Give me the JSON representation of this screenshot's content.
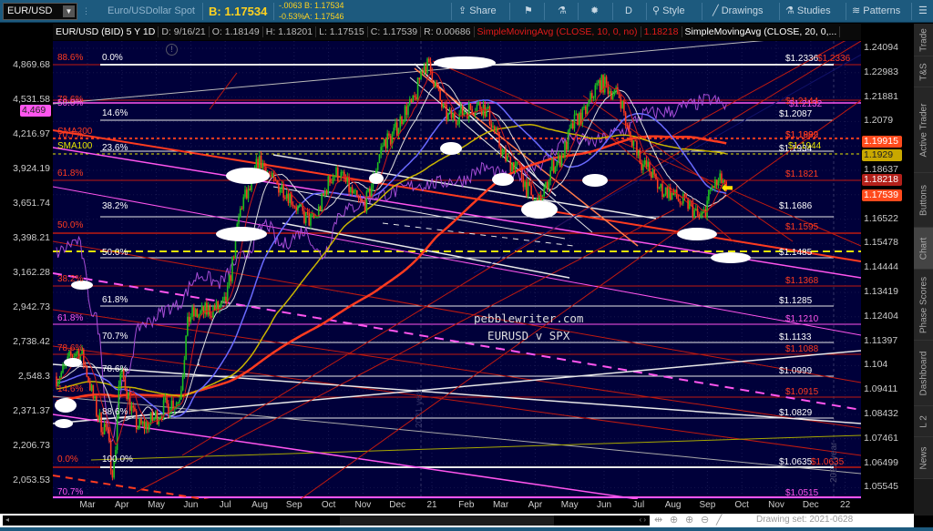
{
  "toolbar": {
    "symbol": "EUR/USD",
    "description": "Euro/USDollar Spot",
    "bid_big": "B: 1.17534",
    "change": "-.0063",
    "change_pct": "-0.53%",
    "bid": "B: 1.17534",
    "ask": "A: 1.17546",
    "share": "Share",
    "period": "D",
    "style": "Style",
    "drawings": "Drawings",
    "studies": "Studies",
    "patterns": "Patterns"
  },
  "infobar": {
    "title": "EUR/USD (BID) 5 Y 1D",
    "date": "D: 9/16/21",
    "open": "O: 1.18149",
    "high": "H: 1.18201",
    "low": "L: 1.17515",
    "close": "C: 1.17539",
    "range": "R: 0.00686",
    "sma10": "SimpleMovingAvg (CLOSE, 10, 0, no)",
    "sma10_value": "1.18218",
    "sma20": "SimpleMovingAvg (CLOSE, 20, 0,..."
  },
  "left_axis": [
    "4,869.68",
    "4,531.58",
    "4,216.97",
    "3,924.19",
    "3,651.74",
    "3,398.21",
    "3,162.28",
    "2,942.73",
    "2,738.42",
    "2,548.3",
    "2,371.37",
    "2,206.73",
    "2,053.53"
  ],
  "left_tag": "4,469",
  "right_axis": [
    "1.24094",
    "1.22983",
    "1.21881",
    "1.2079",
    "1.19705",
    "1.18637",
    "1.17580",
    "1.16522",
    "1.15478",
    "1.14444",
    "1.13419",
    "1.12404",
    "1.11397",
    "1.104",
    "1.09411",
    "1.08432",
    "1.07461",
    "1.06499",
    "1.05545"
  ],
  "price_tags": [
    {
      "text": "1.19915",
      "color": "#ff4a1c"
    },
    {
      "text": "1.1929",
      "color": "#c9a800"
    },
    {
      "text": "1.18218",
      "color": "#b3201a"
    },
    {
      "text": "1.17539",
      "color": "#ff4a1c"
    }
  ],
  "x_axis": [
    "Mar",
    "Apr",
    "May",
    "Jun",
    "Jul",
    "Aug",
    "Sep",
    "Oct",
    "Nov",
    "Dec",
    "21",
    "Feb",
    "Mar",
    "Apr",
    "May",
    "Jun",
    "Jul",
    "Aug",
    "Sep",
    "Oct",
    "Nov",
    "Dec",
    "22"
  ],
  "fib_left": [
    {
      "text": "88.6%",
      "color": "#ff3b1f"
    },
    {
      "text": "0.0%",
      "color": "#ffffff"
    },
    {
      "text": "78.6%",
      "color": "#ff3b1f"
    },
    {
      "text": "50.0%",
      "color": "#ff55ee"
    },
    {
      "text": "14.6%",
      "color": "#ffffff"
    },
    {
      "text": "SMA200",
      "color": "#ff3b1f"
    },
    {
      "text": "70.7%",
      "color": "#ff3b1f"
    },
    {
      "text": "SMA100",
      "color": "#e6e600"
    },
    {
      "text": "23.6%",
      "color": "#ffffff"
    },
    {
      "text": "61.8%",
      "color": "#ff3b1f"
    },
    {
      "text": "38.2%",
      "color": "#ffffff"
    },
    {
      "text": "50.0%",
      "color": "#ff3b1f"
    },
    {
      "text": "50.0%",
      "color": "#ffffff"
    },
    {
      "text": "38.2%",
      "color": "#ff3b1f"
    },
    {
      "text": "61.8%",
      "color": "#ffffff"
    },
    {
      "text": "61.8%",
      "color": "#ff55ee"
    },
    {
      "text": "70.7%",
      "color": "#ffffff"
    },
    {
      "text": "78.6%",
      "color": "#ff3b1f"
    },
    {
      "text": "78.6%",
      "color": "#ffffff"
    },
    {
      "text": "14.6%",
      "color": "#ff3b1f"
    },
    {
      "text": "88.6%",
      "color": "#ffffff"
    },
    {
      "text": "0.0%",
      "color": "#ff3b1f"
    },
    {
      "text": "100.0%",
      "color": "#ffffff"
    },
    {
      "text": "70.7%",
      "color": "#ff55ee"
    }
  ],
  "fib_right": [
    {
      "text": "$1.2336",
      "color": "#ffffff",
      "price": 1.2336
    },
    {
      "text": "$1.2336",
      "color": "#ff3b1f",
      "price": 1.2336
    },
    {
      "text": "$1.2144",
      "color": "#ff3b1f",
      "price": 1.2144
    },
    {
      "text": "$1.2132",
      "color": "#ff55ee",
      "price": 1.2132
    },
    {
      "text": "$1.2087",
      "color": "#ffffff",
      "price": 1.2087
    },
    {
      "text": "$1.1889",
      "color": "#ff3b1f",
      "price": 1.1995
    },
    {
      "text": "$1.1992",
      "color": "#ff3b1f",
      "price": 1.1992
    },
    {
      "text": "$1.1934",
      "color": "#ffffff",
      "price": 1.1934
    },
    {
      "text": "$1.1944",
      "color": "#e6e600",
      "price": 1.1944
    },
    {
      "text": "$1.1821",
      "color": "#ff3b1f",
      "price": 1.1821
    },
    {
      "text": "$1.1686",
      "color": "#ffffff",
      "price": 1.1686
    },
    {
      "text": "$1.1595",
      "color": "#ff3b1f",
      "price": 1.1595
    },
    {
      "text": "$1.1485",
      "color": "#ffffff",
      "price": 1.1485
    },
    {
      "text": "$1.1368",
      "color": "#ff3b1f",
      "price": 1.1368
    },
    {
      "text": "$1.1285",
      "color": "#ffffff",
      "price": 1.1285
    },
    {
      "text": "$1.1210",
      "color": "#ff55ee",
      "price": 1.121
    },
    {
      "text": "$1.1133",
      "color": "#ffffff",
      "price": 1.1133
    },
    {
      "text": "$1.1088",
      "color": "#ff3b1f",
      "price": 1.1088
    },
    {
      "text": "$1.0999",
      "color": "#ffffff",
      "price": 1.0999
    },
    {
      "text": "$1.0915",
      "color": "#ff3b1f",
      "price": 1.0915
    },
    {
      "text": "$1.0829",
      "color": "#ffffff",
      "price": 1.0829
    },
    {
      "text": "$1.0635",
      "color": "#ffffff",
      "price": 1.0635
    },
    {
      "text": "$1.0635",
      "color": "#ff3b1f",
      "price": 1.0635
    },
    {
      "text": "$1.0515",
      "color": "#ff55ee",
      "price": 1.0515
    }
  ],
  "watermark": {
    "line1": "pebblewriter.com",
    "line2": "EURUSD v SPX"
  },
  "year_marker": "2021 year",
  "tabs": [
    "Trade",
    "T&S",
    "Active Trader",
    "Buttons",
    "Chart",
    "Phase Scores",
    "Dashboard",
    "L 2",
    "News"
  ],
  "drawing_set": "Drawing set: 2021-0628",
  "colors": {
    "bg": "#00003a",
    "up": "#1fbf1f",
    "down": "#ff3b1f",
    "spx": "#a64dd6",
    "sma10": "#d01a1a",
    "sma20": "#dddddd",
    "sma50": "#6a6aff",
    "sma100": "#c9b400",
    "sma200": "#ff3b1f"
  },
  "chart_data": {
    "type": "candlestick",
    "eurusd_keypoints_month_price": [
      [
        -0.9,
        1.1
      ],
      [
        -0.3,
        1.11
      ],
      [
        0.5,
        1.08
      ],
      [
        0.75,
        1.0635
      ],
      [
        0.95,
        1.1
      ],
      [
        1.5,
        1.08
      ],
      [
        2.6,
        1.09
      ],
      [
        3.0,
        1.125
      ],
      [
        3.9,
        1.128
      ],
      [
        4.6,
        1.175
      ],
      [
        5.0,
        1.19
      ],
      [
        5.5,
        1.18
      ],
      [
        6.5,
        1.165
      ],
      [
        7.2,
        1.185
      ],
      [
        8.0,
        1.172
      ],
      [
        8.7,
        1.2
      ],
      [
        9.4,
        1.215
      ],
      [
        9.8,
        1.2336
      ],
      [
        10.5,
        1.21
      ],
      [
        11.4,
        1.215
      ],
      [
        12.3,
        1.19
      ],
      [
        13.1,
        1.172
      ],
      [
        13.6,
        1.19
      ],
      [
        14.3,
        1.21
      ],
      [
        14.9,
        1.225
      ],
      [
        15.4,
        1.22
      ],
      [
        15.8,
        1.2
      ],
      [
        16.2,
        1.188
      ],
      [
        16.7,
        1.178
      ],
      [
        17.4,
        1.172
      ],
      [
        17.8,
        1.166
      ],
      [
        18.2,
        1.18
      ],
      [
        18.45,
        1.182
      ],
      [
        18.55,
        1.1754
      ]
    ],
    "spx_keypoints_month_value": [
      [
        -0.9,
        3300
      ],
      [
        -0.3,
        3380
      ],
      [
        0.2,
        2900
      ],
      [
        0.7,
        2237
      ],
      [
        1.0,
        2500
      ],
      [
        1.6,
        2850
      ],
      [
        2.5,
        2950
      ],
      [
        3.3,
        3150
      ],
      [
        3.8,
        3100
      ],
      [
        4.5,
        3270
      ],
      [
        5.2,
        3500
      ],
      [
        5.6,
        3350
      ],
      [
        6.3,
        3450
      ],
      [
        6.8,
        3280
      ],
      [
        7.4,
        3600
      ],
      [
        8.5,
        3720
      ],
      [
        9.7,
        3800
      ],
      [
        10.8,
        3830
      ],
      [
        11.5,
        3930
      ],
      [
        12.3,
        3850
      ],
      [
        13.1,
        3970
      ],
      [
        14.0,
        4180
      ],
      [
        14.7,
        4150
      ],
      [
        15.5,
        4240
      ],
      [
        16.2,
        4400
      ],
      [
        16.9,
        4420
      ],
      [
        17.5,
        4480
      ],
      [
        18.1,
        4530
      ],
      [
        18.55,
        4469
      ]
    ],
    "right_ylim": [
      1.05545,
      1.24094
    ],
    "left_ylim": [
      2053.53,
      4869.68
    ]
  }
}
